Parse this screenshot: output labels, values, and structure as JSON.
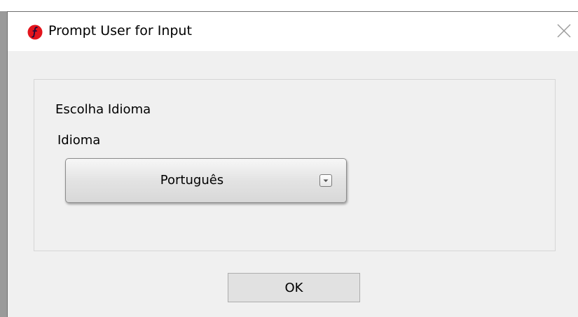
{
  "window": {
    "title": "Prompt User for Input",
    "app_icon": "labview-function-icon",
    "close_icon": "close-x-icon"
  },
  "form": {
    "group_title": "Escolha Idioma",
    "field_label": "Idioma",
    "selected_value": "Português",
    "dropdown_icon": "chevron-down-icon"
  },
  "actions": {
    "ok_label": "OK"
  },
  "colors": {
    "titlebar_bg": "#ffffff",
    "dialog_bg": "#f0f0f0",
    "icon_red": "#e3141c",
    "button_bg": "#e1e1e1"
  }
}
